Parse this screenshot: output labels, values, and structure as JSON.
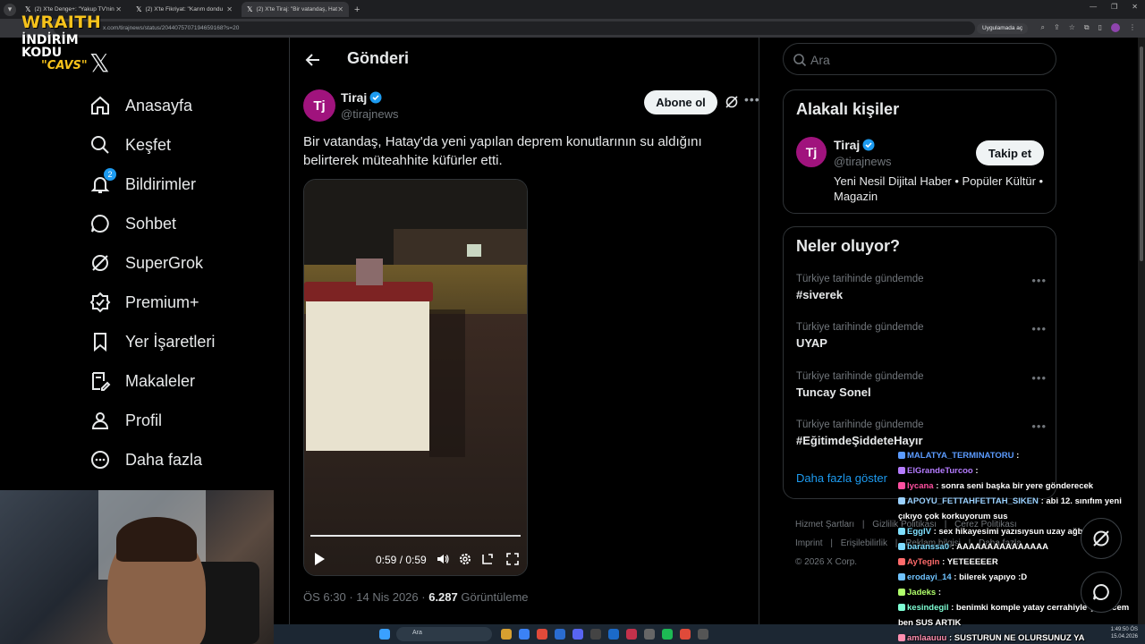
{
  "browser": {
    "tabs": [
      {
        "title": "(2) X'te Denge+: \"Yakup TV'nin",
        "active": false
      },
      {
        "title": "(2) X'te Fikriyat: \"Karım dondu",
        "active": false
      },
      {
        "title": "(2) X'te Tiraj: \"Bir vatandaş, Hat",
        "active": true
      }
    ],
    "url": "x.com/tirajnews/status/2044075707194659168?s=20",
    "open_in_app": "Uygulamada aç"
  },
  "overlay": {
    "brand": "WRAITH",
    "promo_line1": "İNDİRİM KODU",
    "promo_code": "\"CAVS\""
  },
  "nav": {
    "items": [
      {
        "label": "Anasayfa",
        "icon": "home-icon"
      },
      {
        "label": "Keşfet",
        "icon": "search-icon"
      },
      {
        "label": "Bildirimler",
        "icon": "bell-icon",
        "badge": "2"
      },
      {
        "label": "Sohbet",
        "icon": "chat-icon"
      },
      {
        "label": "SuperGrok",
        "icon": "grok-icon"
      },
      {
        "label": "Premium+",
        "icon": "premium-icon"
      },
      {
        "label": "Yer İşaretleri",
        "icon": "bookmark-icon"
      },
      {
        "label": "Makaleler",
        "icon": "articles-icon"
      },
      {
        "label": "Profil",
        "icon": "profile-icon"
      },
      {
        "label": "Daha fazla",
        "icon": "more-circle-icon"
      }
    ]
  },
  "main": {
    "header_title": "Gönderi",
    "author": {
      "name": "Tiraj",
      "handle": "@tirajnews",
      "avatar_text": "Tj"
    },
    "subscribe_label": "Abone ol",
    "text": "Bir vatandaş, Hatay'da yeni yapılan deprem konutlarının su aldığını belirterek müteahhite küfürler etti.",
    "video": {
      "time": "0:59 / 0:59",
      "progress": 1.0
    },
    "meta": {
      "time": "ÖS 6:30",
      "sep": " · ",
      "date": "14 Nis 2026",
      "views": "6.287",
      "views_label": " Görüntüleme"
    }
  },
  "right": {
    "search_placeholder": "Ara",
    "related": {
      "title": "Alakalı kişiler",
      "name": "Tiraj",
      "handle": "@tirajnews",
      "avatar_text": "Tj",
      "bio": "Yeni Nesil Dijital Haber • Popüler Kültür • Magazin",
      "follow_label": "Takip et"
    },
    "trends": {
      "title": "Neler oluyor?",
      "items": [
        {
          "context": "Türkiye tarihinde gündemde",
          "name": "#siverek"
        },
        {
          "context": "Türkiye tarihinde gündemde",
          "name": "UYAP"
        },
        {
          "context": "Türkiye tarihinde gündemde",
          "name": "Tuncay Sonel"
        },
        {
          "context": "Türkiye tarihinde gündemde",
          "name": "#EğitimdeŞiddeteHayır"
        }
      ],
      "show_more": "Daha fazla göster"
    },
    "footer": {
      "line1": [
        "Hizmet Şartları",
        "|",
        "Gizlilik Politikası",
        "|",
        "Çerez Politikası"
      ],
      "line2": [
        "Imprint",
        "|",
        "Erişilebilirlik",
        "|",
        "Reklam bilgisi",
        "|",
        "Daha fazla ..."
      ],
      "copyright": "© 2026 X Corp."
    }
  },
  "chat": [
    {
      "user": "MALATYA_TERMINATORU",
      "msg": ":",
      "color": "#5b9bff"
    },
    {
      "user": "ElGrandeTurcoo",
      "msg": ":",
      "color": "#b57cff"
    },
    {
      "user": "lycana",
      "msg": ": sonra seni başka bir yere gönderecek",
      "color": "#ff4fa0"
    },
    {
      "user": "APOYU_FETTAHFETTAH_SIKEN",
      "msg": ": abi 12. sınıfım yeni çıkıyo çok korkuyorum sus",
      "color": "#9ad1ff"
    },
    {
      "user": "EggIV",
      "msg": ": sex hikayesimi yazısıysun uzay ağbi",
      "color": "#7fe0ff"
    },
    {
      "user": "baranssa0",
      "msg": ": AAAAAAAAAAAAAAA",
      "color": "#7fdcff"
    },
    {
      "user": "AyTegin",
      "msg": ": YETEEEEER",
      "color": "#ff6b6b"
    },
    {
      "user": "erodayi_14",
      "msg": ": bilerek yapıyo :D",
      "color": "#6fc3ff"
    },
    {
      "user": "Jadeks",
      "msg": ":",
      "color": "#b0ff6b"
    },
    {
      "user": "kesindegil",
      "msg": ": benimki komple yatay cerrahiyle çektircem ben SUS ARTIK",
      "color": "#7fffd4"
    },
    {
      "user": "amlaauuu",
      "msg": ": SUSTURUN NE OLURSUNUZ YA",
      "color": "#ff8fb0"
    }
  ],
  "taskbar": {
    "search": "Ara",
    "time": "1:49:50 ÖS",
    "date": "15.04.2026"
  },
  "colors": {
    "accent": "#1d9bf0",
    "brand_pink": "#a0137d",
    "overlay_yellow": "#f6c21b"
  }
}
